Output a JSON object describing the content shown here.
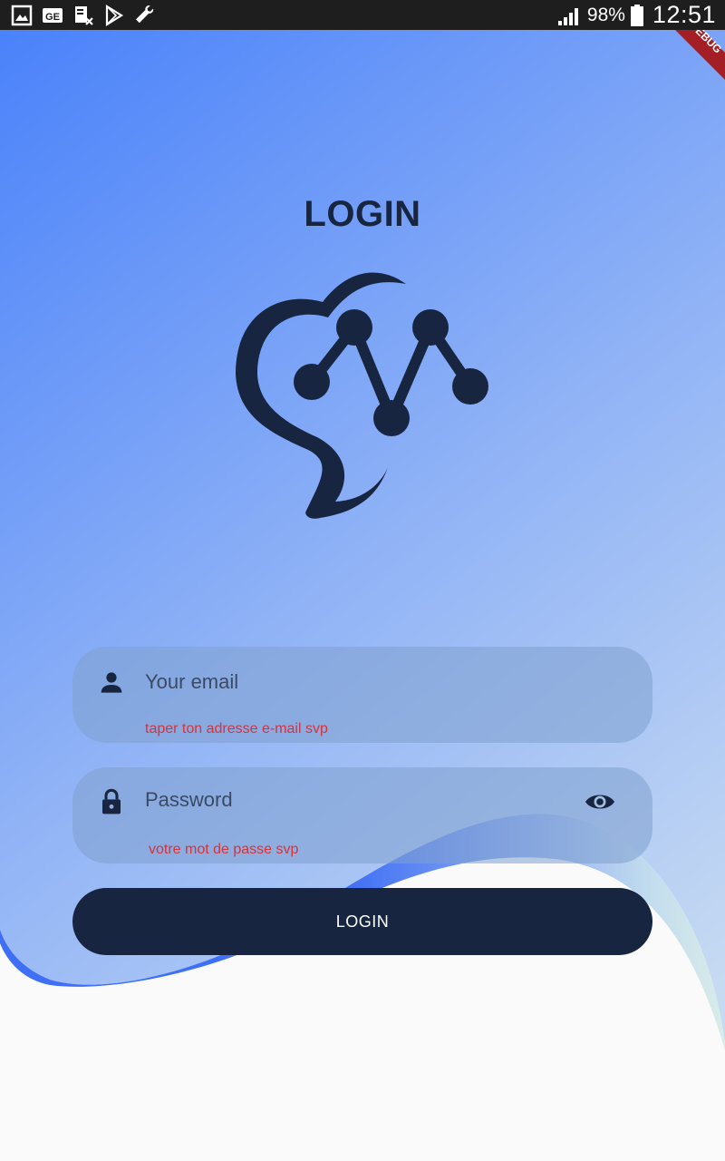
{
  "status_bar": {
    "battery_percent": "98%",
    "time": "12:51",
    "icons": [
      "gallery-icon",
      "ge-icon",
      "document-x-icon",
      "play-store-icon",
      "wrench-icon",
      "signal-icon",
      "battery-icon"
    ]
  },
  "debug_banner": {
    "label": "DEBUG"
  },
  "header": {
    "title": "LOGIN"
  },
  "logo": {
    "icon": "heart-pulse-logo-icon",
    "color": "#172541"
  },
  "form": {
    "email": {
      "icon": "person-icon",
      "placeholder": "Your email",
      "error": "taper ton adresse e-mail svp"
    },
    "password": {
      "icon": "lock-icon",
      "placeholder": "Password",
      "toggle_icon": "eye-icon",
      "error": "votre mot de passe svp"
    },
    "submit_label": "LOGIN"
  },
  "colors": {
    "primary_dark": "#172541",
    "gradient_start": "#4a82fa",
    "gradient_end": "#c6daf2",
    "error": "#d8323a",
    "surface": "#fafafa"
  }
}
